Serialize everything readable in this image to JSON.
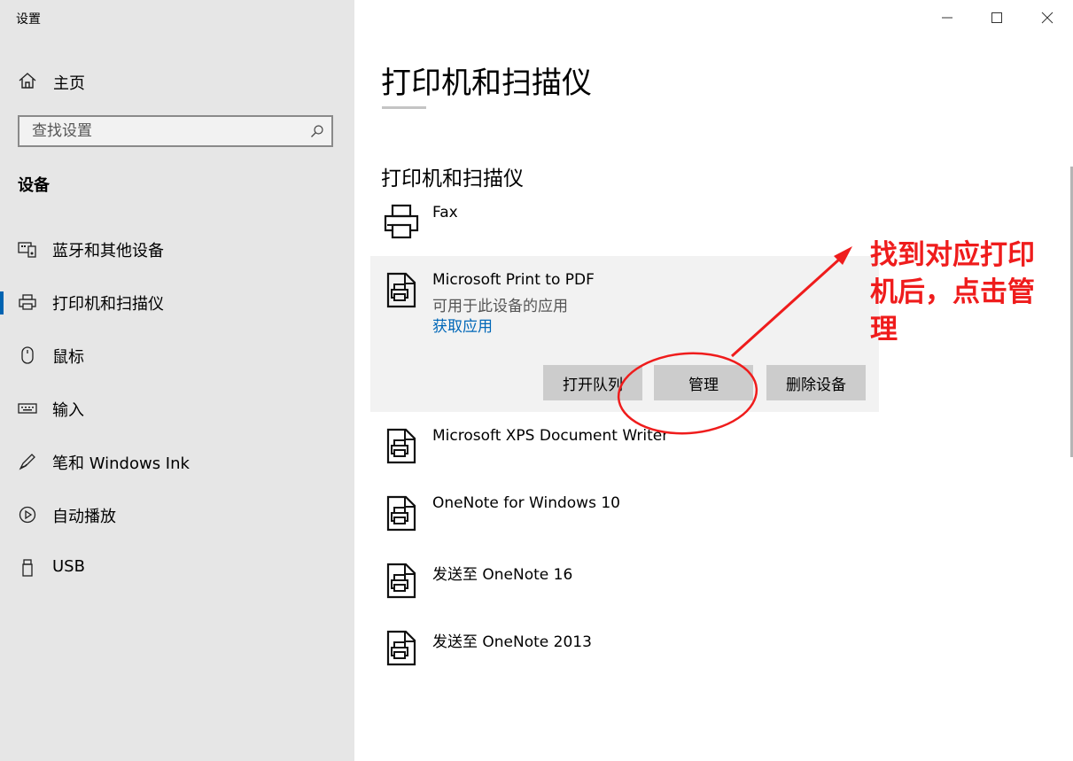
{
  "window": {
    "title": "设置",
    "minimize_icon": "minimize-icon",
    "maximize_icon": "maximize-icon",
    "close_icon": "close-icon"
  },
  "sidebar": {
    "home": {
      "label": "主页",
      "icon": "home-icon"
    },
    "search": {
      "placeholder": "查找设置",
      "value": "",
      "icon": "search-icon"
    },
    "section_title": "设备",
    "items": [
      {
        "label": "蓝牙和其他设备",
        "icon": "bluetooth-devices-icon",
        "selected": false
      },
      {
        "label": "打印机和扫描仪",
        "icon": "printer-icon",
        "selected": true
      },
      {
        "label": "鼠标",
        "icon": "mouse-icon",
        "selected": false
      },
      {
        "label": "输入",
        "icon": "keyboard-icon",
        "selected": false
      },
      {
        "label": "笔和 Windows Ink",
        "icon": "pen-icon",
        "selected": false
      },
      {
        "label": "自动播放",
        "icon": "autoplay-icon",
        "selected": false
      },
      {
        "label": "USB",
        "icon": "usb-icon",
        "selected": false
      }
    ]
  },
  "main": {
    "title": "打印机和扫描仪",
    "subheading": "打印机和扫描仪",
    "printers": [
      {
        "name": "Fax",
        "icon": "fax-printer-icon"
      },
      {
        "name": "Microsoft Print to PDF",
        "icon": "document-printer-icon",
        "expanded": true,
        "description": "可用于此设备的应用",
        "link": "获取应用",
        "buttons": {
          "open_queue": "打开队列",
          "manage": "管理",
          "remove": "删除设备"
        }
      },
      {
        "name": "Microsoft XPS Document Writer",
        "icon": "document-printer-icon"
      },
      {
        "name": "OneNote for Windows 10",
        "icon": "document-printer-icon"
      },
      {
        "name": "发送至 OneNote 16",
        "icon": "document-printer-icon"
      },
      {
        "name": "发送至 OneNote 2013",
        "icon": "document-printer-icon"
      }
    ]
  },
  "annotation": {
    "text": "找到对应打印机后，点击管理",
    "color": "#ef1c1c"
  },
  "colors": {
    "sidebar_bg": "#e6e6e6",
    "accent": "#0063b1",
    "link": "#0067b8",
    "button_bg": "#cccccc",
    "expanded_bg": "#f2f2f2"
  }
}
